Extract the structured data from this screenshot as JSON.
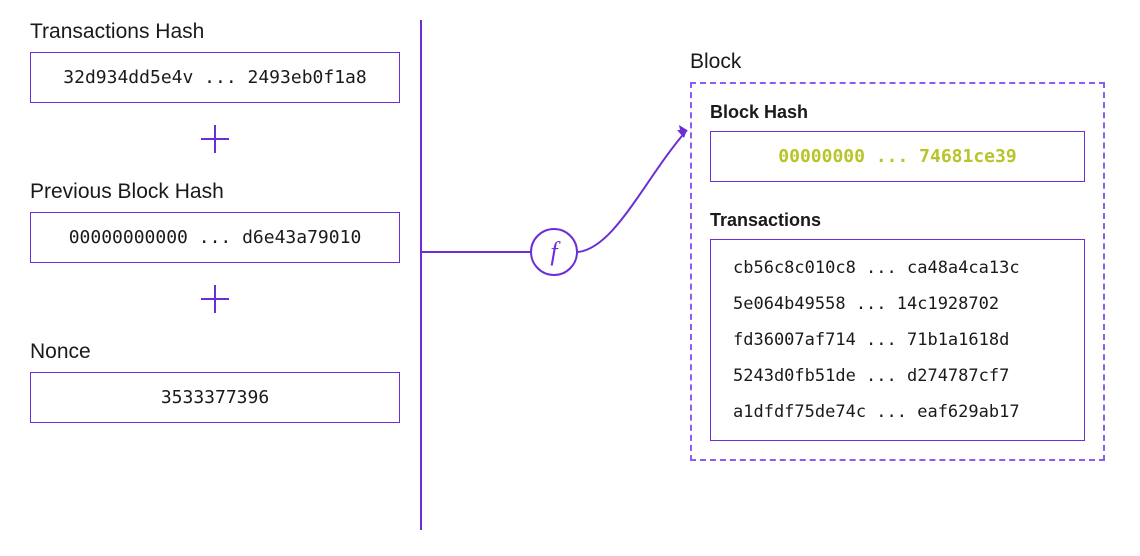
{
  "left": {
    "transactions_hash": {
      "label": "Transactions Hash",
      "value": "32d934dd5e4v ... 2493eb0f1a8"
    },
    "previous_block_hash": {
      "label": "Previous Block Hash",
      "value": "00000000000 ... d6e43a79010"
    },
    "nonce": {
      "label": "Nonce",
      "value": "3533377396"
    }
  },
  "function_symbol": "f",
  "block": {
    "title": "Block",
    "block_hash": {
      "label": "Block Hash",
      "value": "00000000 ... 74681ce39"
    },
    "transactions": {
      "label": "Transactions",
      "items": [
        "cb56c8c010c8 ... ca48a4ca13c",
        "5e064b49558 ... 14c1928702",
        "fd36007af714 ... 71b1a1618d",
        "5243d0fb51de ... d274787cf7",
        "a1dfdf75de74c ... eaf629ab17"
      ]
    }
  },
  "colors": {
    "primary": "#6b2fd6",
    "accent": "#b8c42a"
  }
}
